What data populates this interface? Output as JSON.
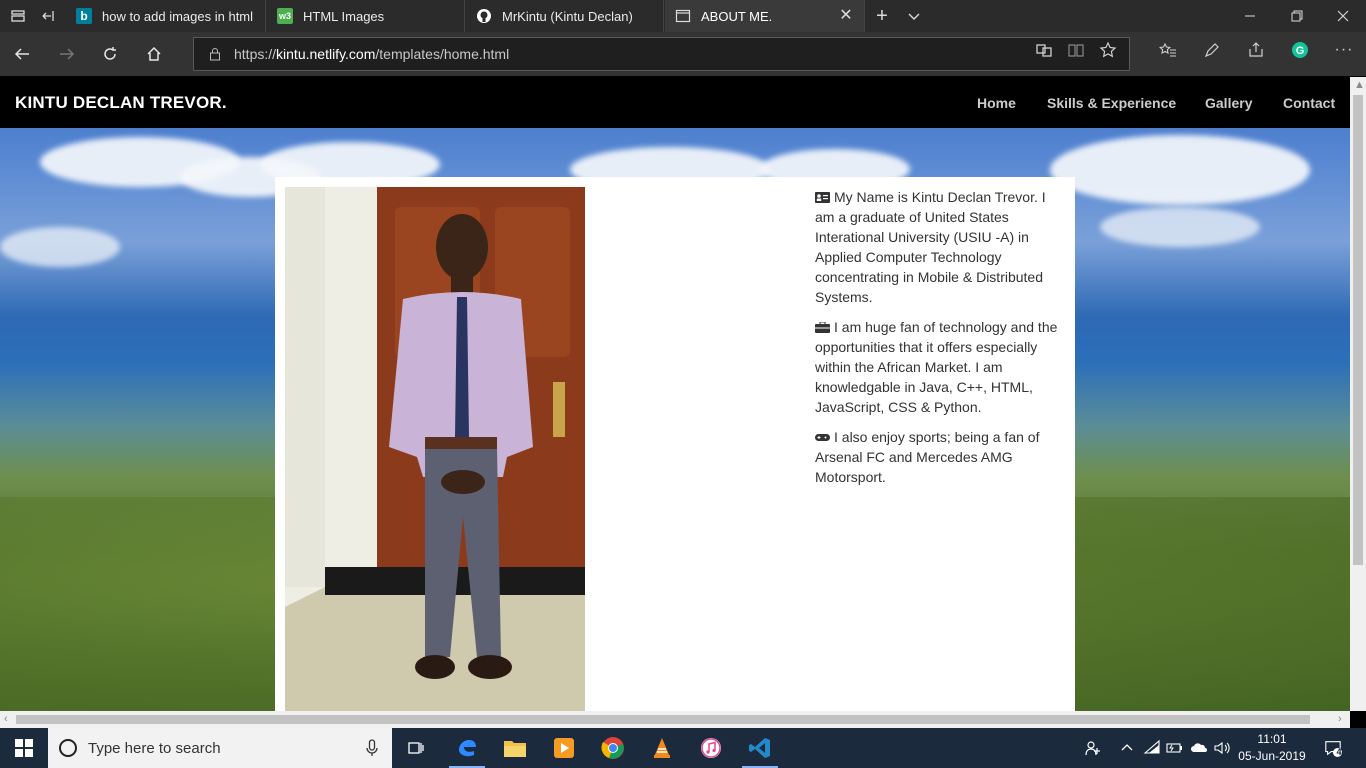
{
  "browser": {
    "tabs": [
      {
        "label": "how to add images in html",
        "favicon": "bing-icon",
        "color": "#00809d"
      },
      {
        "label": "HTML Images",
        "favicon": "w3schools-icon",
        "color": "#4caf50"
      },
      {
        "label": "MrKintu (Kintu Declan)",
        "favicon": "github-icon",
        "color": "#ffffff"
      },
      {
        "label": "ABOUT ME.",
        "favicon": "page-icon",
        "color": "#cccccc",
        "active": true
      }
    ],
    "url_prefix": "https://",
    "url_domain": "kintu.netlify.com",
    "url_path": "/templates/home.html"
  },
  "site": {
    "title": "KINTU DECLAN TREVOR.",
    "nav": [
      "Home",
      "Skills & Experience",
      "Gallery",
      "Contact"
    ]
  },
  "about": {
    "paragraphs": [
      {
        "icon": "id-card-icon",
        "text": "My Name is Kintu Declan Trevor. I am a graduate of United States Interational University (USIU -A) in Applied Computer Technology concentrating in Mobile & Distributed Systems."
      },
      {
        "icon": "briefcase-icon",
        "text": "I am huge fan of technology and the opportunities that it offers especially within the African Market. I am knowledgable in Java, C++, HTML, JavaScript, CSS & Python."
      },
      {
        "icon": "gamepad-icon",
        "text": "I also enjoy sports; being a fan of Arsenal FC and Mercedes AMG Motorsport."
      }
    ]
  },
  "taskbar": {
    "search_placeholder": "Type here to search",
    "time": "11:01",
    "date": "05-Jun-2019",
    "notification_count": "4"
  }
}
